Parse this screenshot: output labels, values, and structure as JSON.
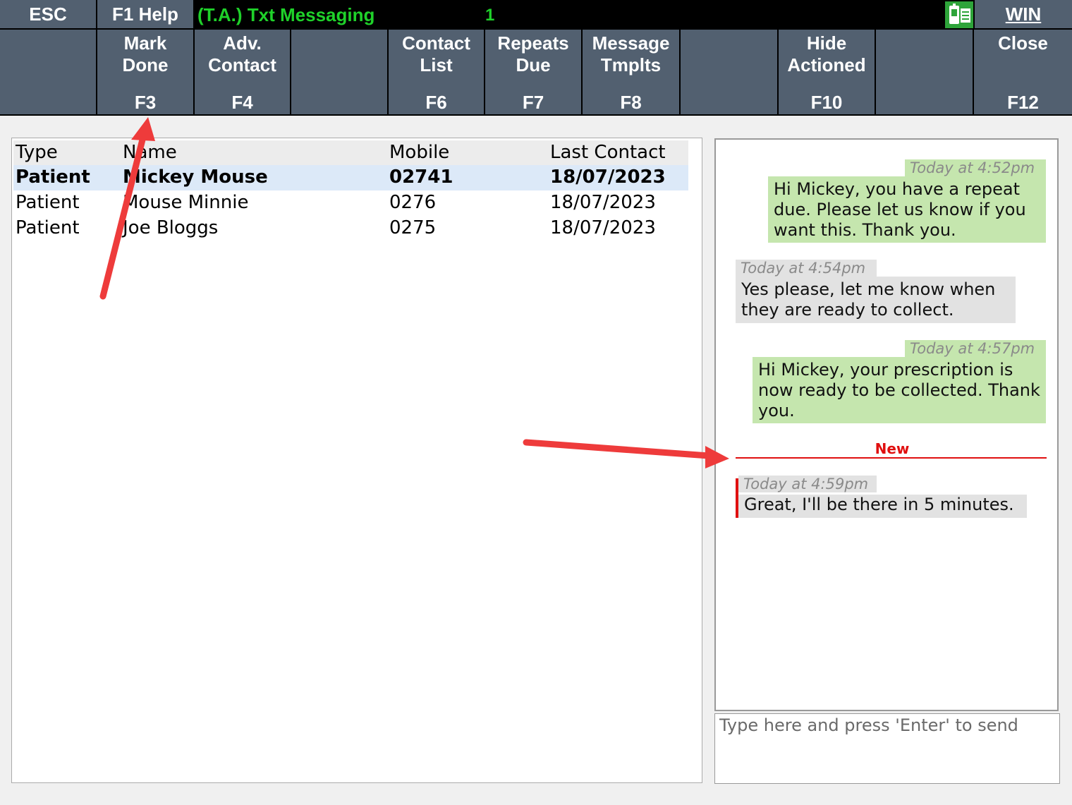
{
  "topbar": {
    "esc": "ESC",
    "help": "F1 Help",
    "title": "(T.A.) Txt Messaging",
    "count": "1",
    "win": "WIN",
    "sms_icon": "sms-phone-icon"
  },
  "fkeys": [
    {
      "label": "",
      "key": ""
    },
    {
      "label": "Mark\nDone",
      "key": "F3"
    },
    {
      "label": "Adv.\nContact",
      "key": "F4"
    },
    {
      "label": "",
      "key": ""
    },
    {
      "label": "Contact\nList",
      "key": "F6"
    },
    {
      "label": "Repeats\nDue",
      "key": "F7"
    },
    {
      "label": "Message\nTmplts",
      "key": "F8"
    },
    {
      "label": "",
      "key": ""
    },
    {
      "label": "Hide\nActioned",
      "key": "F10"
    },
    {
      "label": "",
      "key": ""
    },
    {
      "label": "Close",
      "key": "F12"
    }
  ],
  "contacts": {
    "columns": [
      "Type",
      "Name",
      "Mobile",
      "Last Contact"
    ],
    "rows": [
      {
        "type": "Patient",
        "name": "Mickey Mouse",
        "mobile": "02741",
        "last_contact": "18/07/2023",
        "selected": true
      },
      {
        "type": "Patient",
        "name": "Mouse Minnie",
        "mobile": "0276",
        "last_contact": "18/07/2023",
        "selected": false
      },
      {
        "type": "Patient",
        "name": "Joe Bloggs",
        "mobile": "0275",
        "last_contact": "18/07/2023",
        "selected": false
      }
    ]
  },
  "chat": {
    "messages": [
      {
        "direction": "outgoing",
        "time": "Today at 4:52pm",
        "text": "Hi Mickey, you have a repeat due. Please let us know if you want this. Thank you."
      },
      {
        "direction": "incoming",
        "time": "Today at 4:54pm",
        "text": "Yes please, let me know when they are ready to collect."
      },
      {
        "direction": "outgoing",
        "time": "Today at 4:57pm",
        "text": "Hi Mickey, your prescription is now ready to be collected. Thank you."
      },
      {
        "direction": "incoming",
        "time": "Today at 4:59pm",
        "text": "Great, I'll be there in 5 minutes."
      }
    ],
    "new_label": "New",
    "input_placeholder": "Type here and press 'Enter' to send"
  },
  "colors": {
    "bar_bg": "#526070",
    "title_green": "#1fd12a",
    "outgoing_bubble": "#c5e6ae",
    "incoming_bubble": "#e2e2e2",
    "new_marker": "#e01010",
    "selected_row": "#dce9f8"
  }
}
